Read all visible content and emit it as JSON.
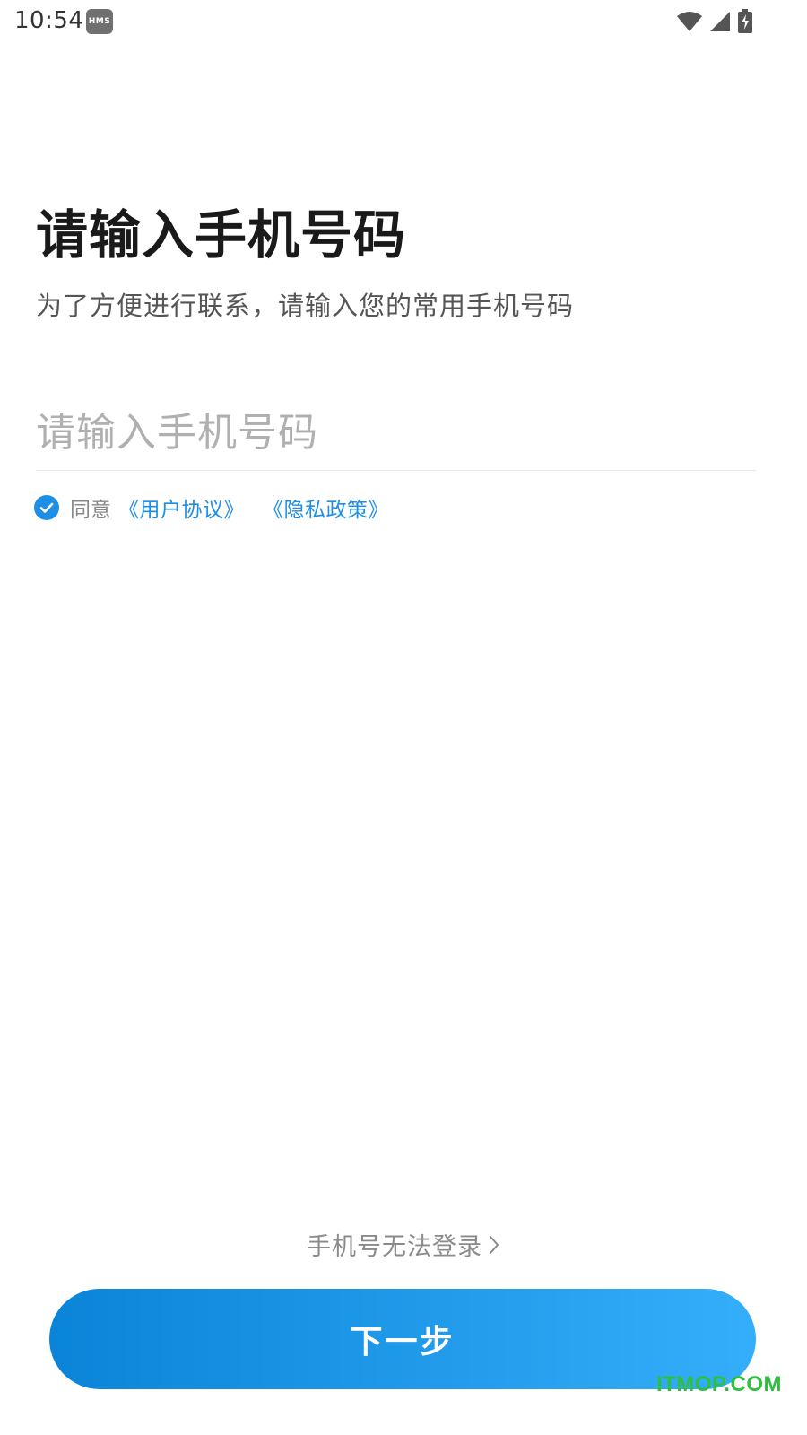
{
  "status_bar": {
    "time": "10:54",
    "badge": "HMS",
    "icons": [
      "wifi-icon",
      "signal-icon",
      "battery-charging-icon"
    ]
  },
  "page": {
    "title": "请输入手机号码",
    "subtitle": "为了方便进行联系，请输入您的常用手机号码"
  },
  "phone_input": {
    "value": "",
    "placeholder": "请输入手机号码"
  },
  "agreement": {
    "checked": true,
    "agree_label": "同意",
    "user_agreement": "《用户协议》",
    "privacy_policy": "《隐私政策》"
  },
  "footer": {
    "cant_login": "手机号无法登录",
    "next_button": "下一步"
  },
  "watermark": "ITMOP.COM",
  "colors": {
    "accent": "#1e8fe6",
    "button_gradient_start": "#0a84d8",
    "button_gradient_end": "#35aefa",
    "watermark": "#2fbf3f"
  }
}
